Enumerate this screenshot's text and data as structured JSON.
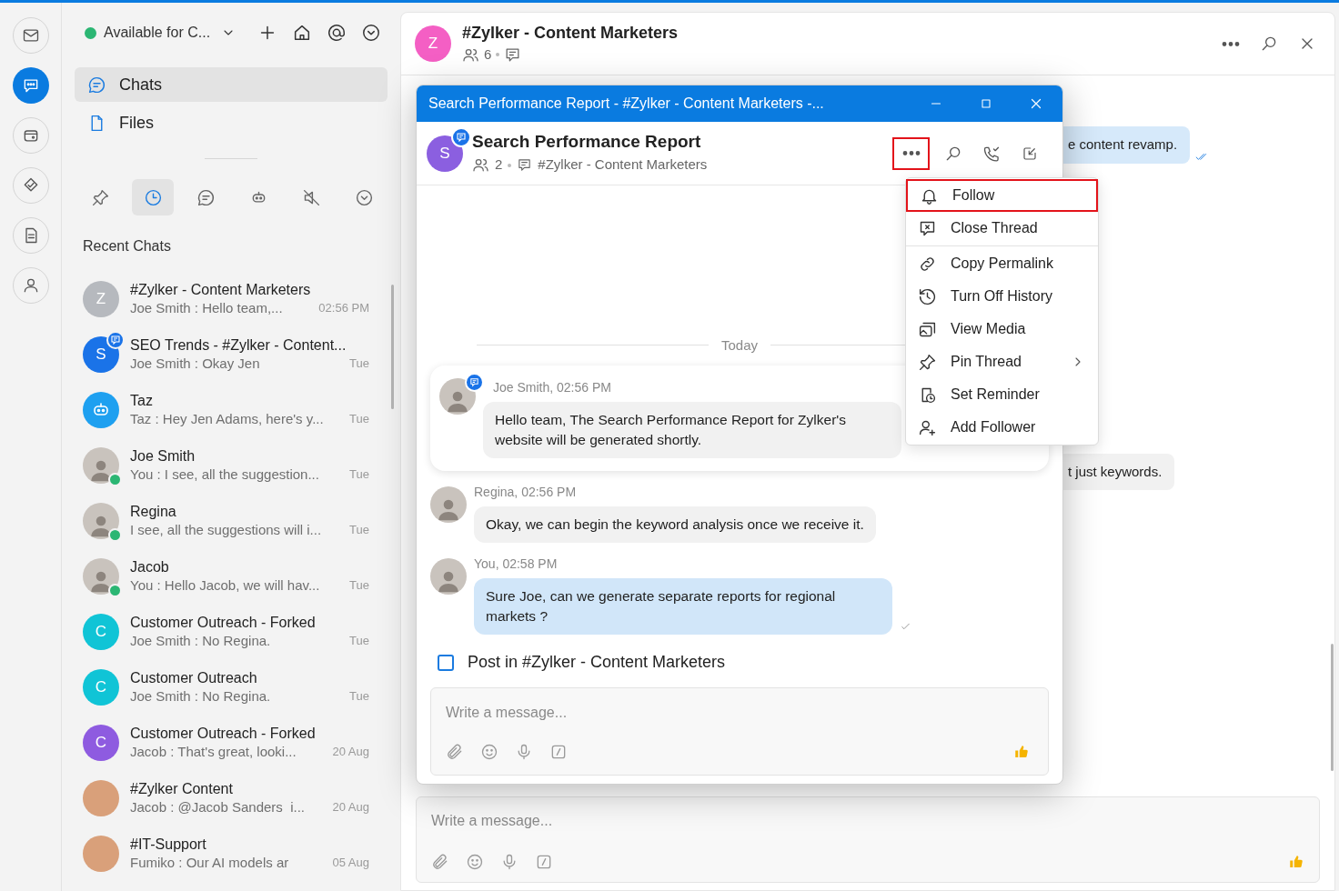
{
  "rail": [
    {
      "kind": "mail",
      "selected": false
    },
    {
      "kind": "chat",
      "selected": true
    },
    {
      "kind": "wallet",
      "selected": false
    },
    {
      "kind": "tasks",
      "selected": false
    },
    {
      "kind": "note",
      "selected": false
    },
    {
      "kind": "person",
      "selected": false
    }
  ],
  "status": {
    "label": "Available for C...",
    "color": "#2bb673"
  },
  "nav": [
    {
      "label": "Chats",
      "kind": "chat",
      "selected": true
    },
    {
      "label": "Files",
      "kind": "file",
      "selected": false
    }
  ],
  "filters": [
    {
      "kind": "pin",
      "selected": false
    },
    {
      "kind": "clock",
      "selected": true
    },
    {
      "kind": "chat",
      "selected": false
    },
    {
      "kind": "bot",
      "selected": false
    },
    {
      "kind": "mute",
      "selected": false
    },
    {
      "kind": "more",
      "selected": false
    }
  ],
  "section_title": "Recent Chats",
  "chats": [
    {
      "name": "#Zylker - Content Marketers",
      "preview": "Joe Smith : Hello team,...",
      "time": "02:56 PM",
      "avatar": {
        "kind": "letter",
        "letter": "Z",
        "color": "#b6b9be"
      },
      "online": false,
      "thread_badge": false
    },
    {
      "name": "SEO Trends - #Zylker - Content...",
      "preview": "Joe Smith : Okay Jen",
      "time": "Tue",
      "avatar": {
        "kind": "letter",
        "letter": "S",
        "color": "#1a73e8"
      },
      "online": false,
      "thread_badge": true
    },
    {
      "name": "Taz",
      "preview": "Taz : Hey Jen Adams, here's y...",
      "time": "Tue",
      "avatar": {
        "kind": "bot"
      },
      "online": false,
      "thread_badge": false
    },
    {
      "name": "Joe Smith",
      "preview": "You : I see, all the suggestion...",
      "time": "Tue",
      "avatar": {
        "kind": "photo"
      },
      "online": true,
      "thread_badge": false
    },
    {
      "name": "Regina",
      "preview": "I see, all the suggestions will i...",
      "time": "Tue",
      "avatar": {
        "kind": "photo"
      },
      "online": true,
      "thread_badge": false
    },
    {
      "name": "Jacob",
      "preview": "You : Hello Jacob, we will hav...",
      "time": "Tue",
      "avatar": {
        "kind": "photo"
      },
      "online": true,
      "thread_badge": false
    },
    {
      "name": "Customer Outreach - Forked",
      "preview": "Joe Smith : No Regina.",
      "time": "Tue",
      "avatar": {
        "kind": "letter",
        "letter": "C",
        "color": "#10c4d6"
      },
      "online": false,
      "thread_badge": false
    },
    {
      "name": "Customer Outreach",
      "preview": "Joe Smith : No Regina.",
      "time": "Tue",
      "avatar": {
        "kind": "letter",
        "letter": "C",
        "color": "#10c4d6"
      },
      "online": false,
      "thread_badge": false
    },
    {
      "name": "Customer Outreach - Forked",
      "preview": "Jacob : That's great, looki...",
      "time": "20 Aug",
      "avatar": {
        "kind": "letter",
        "letter": "C",
        "color": "#8e5be0"
      },
      "online": false,
      "thread_badge": false
    },
    {
      "name": "#Zylker Content",
      "preview": "Jacob : @Jacob Sanders  i...",
      "time": "20 Aug",
      "avatar": {
        "kind": "image"
      },
      "online": false,
      "thread_badge": false
    },
    {
      "name": "#IT-Support",
      "preview": "Fumiko : Our AI models ar",
      "time": "05 Aug",
      "avatar": {
        "kind": "image"
      },
      "online": false,
      "thread_badge": false
    }
  ],
  "conversation": {
    "title": "#Zylker - Content Marketers",
    "avatar": {
      "letter": "Z",
      "color": "#f45fc4"
    },
    "members": "6",
    "messages": [
      {
        "text": "e content revamp.",
        "mine": true,
        "read": true
      },
      {
        "text": "t just keywords.",
        "mine": false
      }
    ],
    "composer": {
      "placeholder": "Write a message..."
    }
  },
  "thread_window": {
    "title_bar": "Search Performance Report - #Zylker - Content Marketers -...",
    "title": "Search Performance Report",
    "avatar": {
      "letter": "S",
      "color": "#8b5fe0"
    },
    "members": "2",
    "parent": "#Zylker - Content Marketers",
    "more_highlighted": true,
    "date_divider": "Today",
    "messages": [
      {
        "kind": "parent",
        "author_time": "Joe Smith, 02:56 PM",
        "text": "Hello team, The Search Performance Report for Zylker's website will be generated shortly.",
        "mine": false
      },
      {
        "kind": "reply",
        "author_time": "Regina, 02:56 PM",
        "text": "Okay, we can begin the keyword analysis once we receive it.",
        "mine": false
      },
      {
        "kind": "reply",
        "author_time": "You, 02:58 PM",
        "text": "Sure Joe, can we generate separate reports for regional markets ?",
        "mine": true,
        "read": false
      }
    ],
    "post_in_channel": {
      "label": "Post in #Zylker - Content Marketers",
      "checked": false
    },
    "composer": {
      "placeholder": "Write a message..."
    }
  },
  "menu": [
    {
      "label": "Follow",
      "kind": "bell",
      "highlighted": true,
      "divider_after": false,
      "submenu": false
    },
    {
      "label": "Close Thread",
      "kind": "close-thread",
      "highlighted": false,
      "divider_after": true,
      "submenu": false
    },
    {
      "label": "Copy Permalink",
      "kind": "link",
      "highlighted": false,
      "divider_after": false,
      "submenu": false
    },
    {
      "label": "Turn Off History",
      "kind": "history",
      "highlighted": false,
      "divider_after": false,
      "submenu": false
    },
    {
      "label": "View Media",
      "kind": "media",
      "highlighted": false,
      "divider_after": false,
      "submenu": false
    },
    {
      "label": "Pin Thread",
      "kind": "pin",
      "highlighted": false,
      "divider_after": false,
      "submenu": true
    },
    {
      "label": "Set Reminder",
      "kind": "reminder",
      "highlighted": false,
      "divider_after": false,
      "submenu": false
    },
    {
      "label": "Add Follower",
      "kind": "add-user",
      "highlighted": false,
      "divider_after": false,
      "submenu": false
    }
  ]
}
